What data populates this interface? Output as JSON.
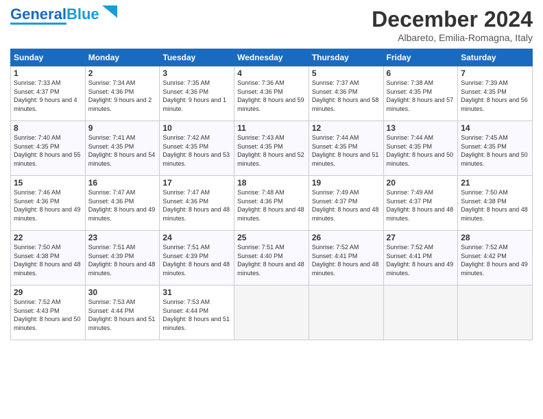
{
  "header": {
    "logo_general": "General",
    "logo_blue": "Blue",
    "month_title": "December 2024",
    "location": "Albareto, Emilia-Romagna, Italy"
  },
  "days_of_week": [
    "Sunday",
    "Monday",
    "Tuesday",
    "Wednesday",
    "Thursday",
    "Friday",
    "Saturday"
  ],
  "weeks": [
    [
      {
        "day": "1",
        "sunrise": "7:33 AM",
        "sunset": "4:37 PM",
        "daylight": "9 hours and 4 minutes."
      },
      {
        "day": "2",
        "sunrise": "7:34 AM",
        "sunset": "4:36 PM",
        "daylight": "9 hours and 2 minutes."
      },
      {
        "day": "3",
        "sunrise": "7:35 AM",
        "sunset": "4:36 PM",
        "daylight": "9 hours and 1 minute."
      },
      {
        "day": "4",
        "sunrise": "7:36 AM",
        "sunset": "4:36 PM",
        "daylight": "8 hours and 59 minutes."
      },
      {
        "day": "5",
        "sunrise": "7:37 AM",
        "sunset": "4:36 PM",
        "daylight": "8 hours and 58 minutes."
      },
      {
        "day": "6",
        "sunrise": "7:38 AM",
        "sunset": "4:35 PM",
        "daylight": "8 hours and 57 minutes."
      },
      {
        "day": "7",
        "sunrise": "7:39 AM",
        "sunset": "4:35 PM",
        "daylight": "8 hours and 56 minutes."
      }
    ],
    [
      {
        "day": "8",
        "sunrise": "7:40 AM",
        "sunset": "4:35 PM",
        "daylight": "8 hours and 55 minutes."
      },
      {
        "day": "9",
        "sunrise": "7:41 AM",
        "sunset": "4:35 PM",
        "daylight": "8 hours and 54 minutes."
      },
      {
        "day": "10",
        "sunrise": "7:42 AM",
        "sunset": "4:35 PM",
        "daylight": "8 hours and 53 minutes."
      },
      {
        "day": "11",
        "sunrise": "7:43 AM",
        "sunset": "4:35 PM",
        "daylight": "8 hours and 52 minutes."
      },
      {
        "day": "12",
        "sunrise": "7:44 AM",
        "sunset": "4:35 PM",
        "daylight": "8 hours and 51 minutes."
      },
      {
        "day": "13",
        "sunrise": "7:44 AM",
        "sunset": "4:35 PM",
        "daylight": "8 hours and 50 minutes."
      },
      {
        "day": "14",
        "sunrise": "7:45 AM",
        "sunset": "4:35 PM",
        "daylight": "8 hours and 50 minutes."
      }
    ],
    [
      {
        "day": "15",
        "sunrise": "7:46 AM",
        "sunset": "4:36 PM",
        "daylight": "8 hours and 49 minutes."
      },
      {
        "day": "16",
        "sunrise": "7:47 AM",
        "sunset": "4:36 PM",
        "daylight": "8 hours and 49 minutes."
      },
      {
        "day": "17",
        "sunrise": "7:47 AM",
        "sunset": "4:36 PM",
        "daylight": "8 hours and 48 minutes."
      },
      {
        "day": "18",
        "sunrise": "7:48 AM",
        "sunset": "4:36 PM",
        "daylight": "8 hours and 48 minutes."
      },
      {
        "day": "19",
        "sunrise": "7:49 AM",
        "sunset": "4:37 PM",
        "daylight": "8 hours and 48 minutes."
      },
      {
        "day": "20",
        "sunrise": "7:49 AM",
        "sunset": "4:37 PM",
        "daylight": "8 hours and 48 minutes."
      },
      {
        "day": "21",
        "sunrise": "7:50 AM",
        "sunset": "4:38 PM",
        "daylight": "8 hours and 48 minutes."
      }
    ],
    [
      {
        "day": "22",
        "sunrise": "7:50 AM",
        "sunset": "4:38 PM",
        "daylight": "8 hours and 48 minutes."
      },
      {
        "day": "23",
        "sunrise": "7:51 AM",
        "sunset": "4:39 PM",
        "daylight": "8 hours and 48 minutes."
      },
      {
        "day": "24",
        "sunrise": "7:51 AM",
        "sunset": "4:39 PM",
        "daylight": "8 hours and 48 minutes."
      },
      {
        "day": "25",
        "sunrise": "7:51 AM",
        "sunset": "4:40 PM",
        "daylight": "8 hours and 48 minutes."
      },
      {
        "day": "26",
        "sunrise": "7:52 AM",
        "sunset": "4:41 PM",
        "daylight": "8 hours and 48 minutes."
      },
      {
        "day": "27",
        "sunrise": "7:52 AM",
        "sunset": "4:41 PM",
        "daylight": "8 hours and 49 minutes."
      },
      {
        "day": "28",
        "sunrise": "7:52 AM",
        "sunset": "4:42 PM",
        "daylight": "8 hours and 49 minutes."
      }
    ],
    [
      {
        "day": "29",
        "sunrise": "7:52 AM",
        "sunset": "4:43 PM",
        "daylight": "8 hours and 50 minutes."
      },
      {
        "day": "30",
        "sunrise": "7:53 AM",
        "sunset": "4:44 PM",
        "daylight": "8 hours and 51 minutes."
      },
      {
        "day": "31",
        "sunrise": "7:53 AM",
        "sunset": "4:44 PM",
        "daylight": "8 hours and 51 minutes."
      },
      null,
      null,
      null,
      null
    ]
  ]
}
